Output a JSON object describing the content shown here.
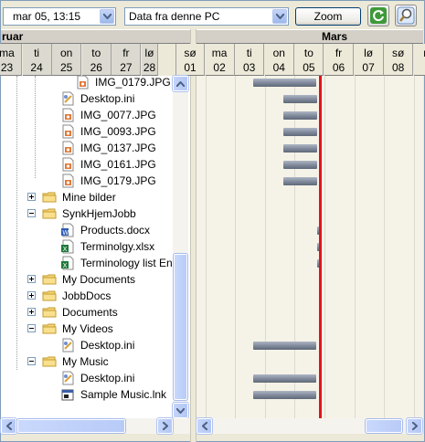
{
  "toolbar": {
    "date_value": "mar 05,  13:15",
    "source_value": "Data fra denne PC",
    "zoom_label": "Zoom",
    "refresh_icon": "refresh-icon",
    "search_icon": "search-icon"
  },
  "timeline": {
    "months": [
      {
        "label": "ruar"
      },
      {
        "label": "Mars"
      }
    ],
    "days": [
      {
        "wd": "ma",
        "d": "23"
      },
      {
        "wd": "ti",
        "d": "24"
      },
      {
        "wd": "on",
        "d": "25"
      },
      {
        "wd": "to",
        "d": "26"
      },
      {
        "wd": "fr",
        "d": "27"
      },
      {
        "wd": "lø",
        "d": "28"
      },
      {
        "wd": "sø",
        "d": "01"
      },
      {
        "wd": "ma",
        "d": "02"
      },
      {
        "wd": "ti",
        "d": "03"
      },
      {
        "wd": "on",
        "d": "04"
      },
      {
        "wd": "to",
        "d": "05"
      },
      {
        "wd": "fr",
        "d": "06"
      },
      {
        "wd": "lø",
        "d": "07"
      },
      {
        "wd": "sø",
        "d": "08"
      },
      {
        "wd": "m",
        "d": ""
      }
    ],
    "today_color": "#e4111a"
  },
  "tree": {
    "items": [
      {
        "label": "IMG_0179.JPG",
        "icon": "image-file-icon",
        "indent": 3,
        "expander": ""
      },
      {
        "label": "Desktop.ini",
        "icon": "settings-file-icon",
        "indent": 2,
        "expander": ""
      },
      {
        "label": "IMG_0077.JPG",
        "icon": "image-file-icon",
        "indent": 2,
        "expander": ""
      },
      {
        "label": "IMG_0093.JPG",
        "icon": "image-file-icon",
        "indent": 2,
        "expander": ""
      },
      {
        "label": "IMG_0137.JPG",
        "icon": "image-file-icon",
        "indent": 2,
        "expander": ""
      },
      {
        "label": "IMG_0161.JPG",
        "icon": "image-file-icon",
        "indent": 2,
        "expander": ""
      },
      {
        "label": "IMG_0179.JPG",
        "icon": "image-file-icon",
        "indent": 2,
        "expander": ""
      },
      {
        "label": "Mine bilder",
        "icon": "folder-icon",
        "indent": 1,
        "expander": "plus"
      },
      {
        "label": "SynkHjemJobb",
        "icon": "folder-icon",
        "indent": 1,
        "expander": "minus"
      },
      {
        "label": "Products.docx",
        "icon": "word-file-icon",
        "indent": 2,
        "expander": ""
      },
      {
        "label": "Terminolgy.xlsx",
        "icon": "excel-file-icon",
        "indent": 2,
        "expander": ""
      },
      {
        "label": "Terminology list Eng_",
        "icon": "excel-file-icon",
        "indent": 2,
        "expander": ""
      },
      {
        "label": "My Documents",
        "icon": "folder-icon",
        "indent": 1,
        "expander": "plus"
      },
      {
        "label": "JobbDocs",
        "icon": "folder-icon",
        "indent": 1,
        "expander": "plus"
      },
      {
        "label": "Documents",
        "icon": "folder-icon",
        "indent": 1,
        "expander": "plus"
      },
      {
        "label": "My Videos",
        "icon": "folder-icon",
        "indent": 1,
        "expander": "minus"
      },
      {
        "label": "Desktop.ini",
        "icon": "settings-file-icon",
        "indent": 2,
        "expander": ""
      },
      {
        "label": "My Music",
        "icon": "folder-icon",
        "indent": 1,
        "expander": "minus"
      },
      {
        "label": "Desktop.ini",
        "icon": "settings-file-icon",
        "indent": 2,
        "expander": ""
      },
      {
        "label": "Sample Music.lnk",
        "icon": "shortcut-file-icon",
        "indent": 2,
        "expander": ""
      }
    ]
  },
  "activity_bars": [
    {
      "row": 0,
      "start": "03",
      "end": "05"
    },
    {
      "row": 1,
      "start": "04",
      "end": "05"
    },
    {
      "row": 2,
      "start": "04",
      "end": "05"
    },
    {
      "row": 3,
      "start": "04",
      "end": "05"
    },
    {
      "row": 4,
      "start": "04",
      "end": "05"
    },
    {
      "row": 5,
      "start": "04",
      "end": "05"
    },
    {
      "row": 6,
      "start": "04",
      "end": "05"
    },
    {
      "row": 9,
      "start": "05",
      "end": "05"
    },
    {
      "row": 10,
      "start": "05",
      "end": "05"
    },
    {
      "row": 11,
      "start": "05",
      "end": "05"
    },
    {
      "row": 16,
      "start": "03",
      "end": "05"
    },
    {
      "row": 18,
      "start": "03",
      "end": "05"
    },
    {
      "row": 19,
      "start": "03",
      "end": "05"
    }
  ]
}
